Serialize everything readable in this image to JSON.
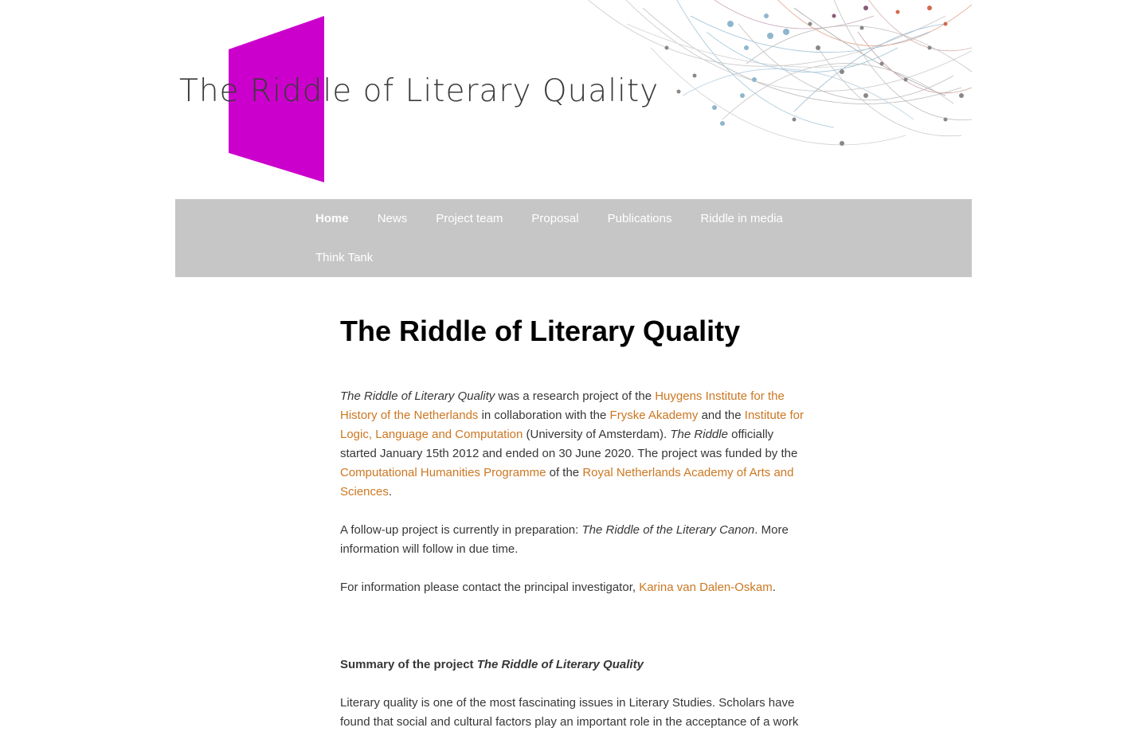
{
  "site": {
    "logo_word_1": "The R",
    "logo_word_2": "iddle of Literary Quality",
    "logo_accent_color": "#cc00cc"
  },
  "nav": {
    "items": [
      {
        "label": "Home"
      },
      {
        "label": "News"
      },
      {
        "label": "Project team"
      },
      {
        "label": "Proposal"
      },
      {
        "label": "Publications"
      },
      {
        "label": "Riddle in media"
      },
      {
        "label": "Think Tank"
      }
    ]
  },
  "main": {
    "title": "The Riddle of Literary Quality",
    "p1": {
      "t1": "The Riddle of Literary Quality",
      "t2": " was a research project of the ",
      "l1": "Huygens Institute for the History of the Netherlands",
      "t3": " in collaboration with the ",
      "l2": "Fryske Akademy",
      "t4": " and the ",
      "l3": "Institute for Logic, Language and Computation",
      "t5": " (University of Amsterdam). ",
      "t6": "The Riddle",
      "t7": " officially started January 15th 2012 and ended on 30 June 2020. The project was funded by the ",
      "l4": "Computational Humanities Programme",
      "t8": " of the ",
      "l5": "Royal Netherlands Academy of Arts and Sciences",
      "t9": "."
    },
    "p2": {
      "t1": "A follow-up project is currently in preparation: ",
      "t2": "The Riddle of the Literary Canon",
      "t3": ". More information will follow in due time."
    },
    "p3": {
      "t1": "For information please contact the principal investigator, ",
      "l1": "Karina van Dalen-Oskam",
      "t2": "."
    },
    "summary": {
      "t1": "Summary of the project ",
      "t2": "The Riddle of Literary Quality"
    },
    "p4": "Literary quality is one of the most fascinating issues in Literary Studies. Scholars have found that social and cultural factors play an important role in the acceptance of a work"
  },
  "colors": {
    "link": "#cc7722",
    "nav_bg": "#c6c6c6",
    "accent": "#cc00cc"
  }
}
